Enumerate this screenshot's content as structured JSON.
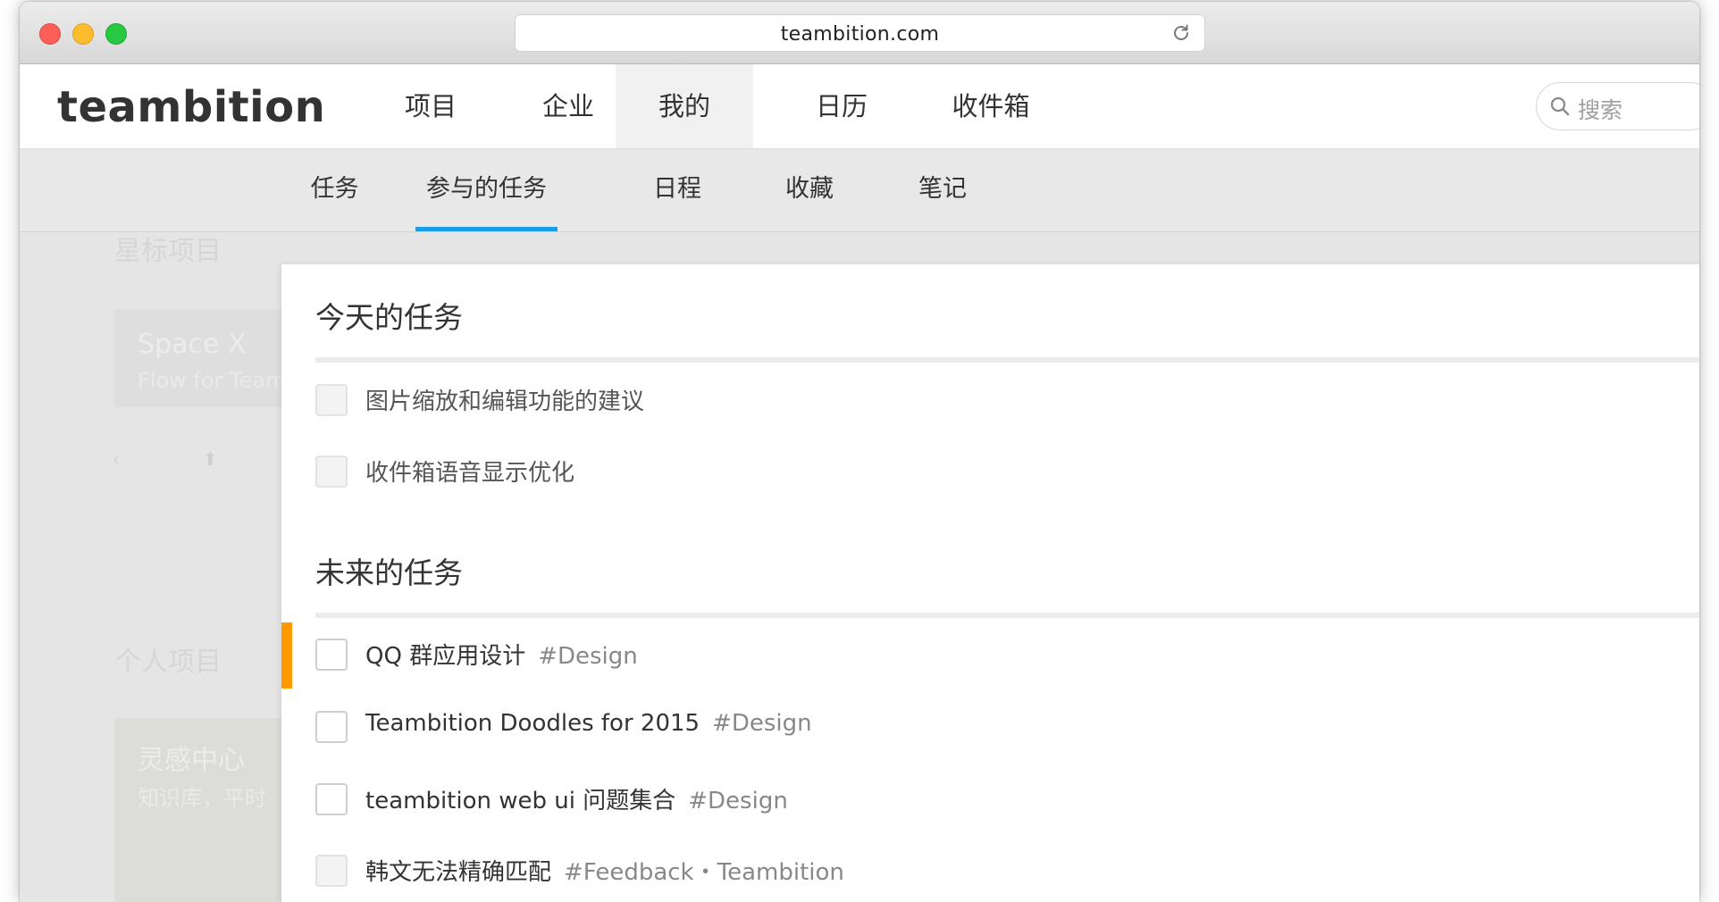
{
  "browser": {
    "url": "teambition.com",
    "icons": {
      "reload": "reload-icon"
    }
  },
  "app": {
    "logo": "teambition",
    "nav": [
      {
        "label": "项目",
        "active": false
      },
      {
        "label": "企业",
        "active": false
      },
      {
        "label": "我的",
        "active": true
      },
      {
        "label": "日历",
        "active": false
      },
      {
        "label": "收件箱",
        "active": false
      }
    ],
    "search": {
      "placeholder": "搜索",
      "icon": "search-icon"
    },
    "subnav": [
      {
        "label": "任务",
        "active": false
      },
      {
        "label": "参与的任务",
        "active": true
      },
      {
        "label": "日程",
        "active": false
      },
      {
        "label": "收藏",
        "active": false
      },
      {
        "label": "笔记",
        "active": false
      }
    ],
    "accent_color": "#1a9ee8",
    "priority_color": "#ff9900"
  },
  "background": {
    "starred_heading": "星标项目",
    "starred_card_title": "Space X",
    "starred_card_sub": "Flow for Team",
    "personal_heading": "个人项目",
    "personal_card_title": "灵感中心",
    "personal_card_sub": "知识库，平时"
  },
  "tasks": {
    "today": {
      "title": "今天的任务",
      "items": [
        {
          "title": "图片缩放和编辑功能的建议",
          "tag": "",
          "done_style": true
        },
        {
          "title": "收件箱语音显示优化",
          "tag": "",
          "done_style": true
        }
      ]
    },
    "future": {
      "title": "未来的任务",
      "items": [
        {
          "title": "QQ 群应用设计",
          "tag": "#Design",
          "priority": true,
          "done_style": false
        },
        {
          "title": "Teambition Doodles for 2015",
          "tag": "#Design",
          "priority": false,
          "done_style": false
        },
        {
          "title": "teambition web ui 问题集合",
          "tag": "#Design",
          "priority": false,
          "done_style": false
        },
        {
          "title": "韩文无法精确匹配",
          "tag": "#Feedback・Teambition",
          "priority": false,
          "done_style": true
        }
      ]
    }
  }
}
